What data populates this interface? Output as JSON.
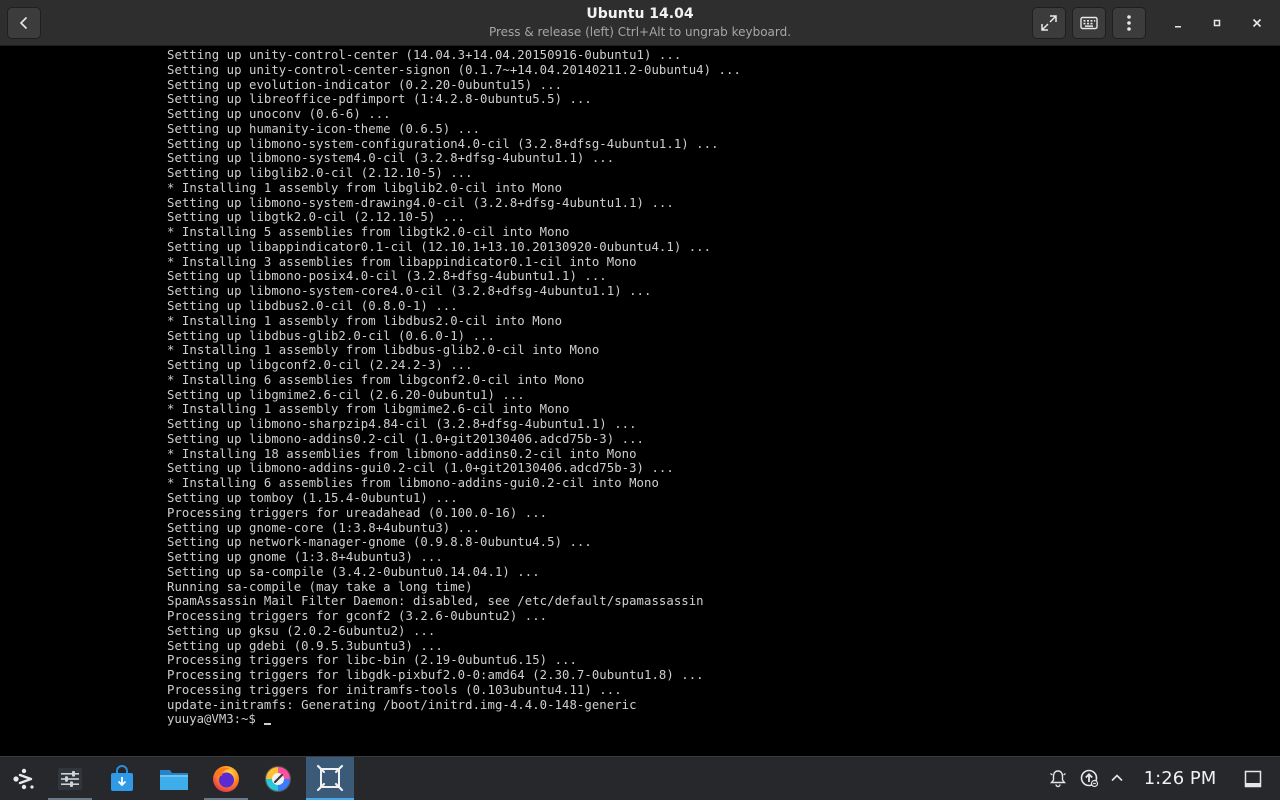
{
  "window": {
    "title": "Ubuntu 14.04",
    "subtitle": "Press & release (left) Ctrl+Alt to ungrab keyboard."
  },
  "icons": {
    "back": "chevron-left-icon",
    "fullscreen": "fullscreen-icon",
    "keyboard": "keyboard-icon",
    "menu": "kebab-menu-icon",
    "minimize": "minimize-icon",
    "maximize": "maximize-icon",
    "close": "close-icon"
  },
  "terminal": {
    "lines": [
      "Setting up unity-control-center (14.04.3+14.04.20150916-0ubuntu1) ...",
      "Setting up unity-control-center-signon (0.1.7~+14.04.20140211.2-0ubuntu4) ...",
      "Setting up evolution-indicator (0.2.20-0ubuntu15) ...",
      "Setting up libreoffice-pdfimport (1:4.2.8-0ubuntu5.5) ...",
      "Setting up unoconv (0.6-6) ...",
      "Setting up humanity-icon-theme (0.6.5) ...",
      "Setting up libmono-system-configuration4.0-cil (3.2.8+dfsg-4ubuntu1.1) ...",
      "Setting up libmono-system4.0-cil (3.2.8+dfsg-4ubuntu1.1) ...",
      "Setting up libglib2.0-cil (2.12.10-5) ...",
      "* Installing 1 assembly from libglib2.0-cil into Mono",
      "Setting up libmono-system-drawing4.0-cil (3.2.8+dfsg-4ubuntu1.1) ...",
      "Setting up libgtk2.0-cil (2.12.10-5) ...",
      "* Installing 5 assemblies from libgtk2.0-cil into Mono",
      "Setting up libappindicator0.1-cil (12.10.1+13.10.20130920-0ubuntu4.1) ...",
      "* Installing 3 assemblies from libappindicator0.1-cil into Mono",
      "Setting up libmono-posix4.0-cil (3.2.8+dfsg-4ubuntu1.1) ...",
      "Setting up libmono-system-core4.0-cil (3.2.8+dfsg-4ubuntu1.1) ...",
      "Setting up libdbus2.0-cil (0.8.0-1) ...",
      "* Installing 1 assembly from libdbus2.0-cil into Mono",
      "Setting up libdbus-glib2.0-cil (0.6.0-1) ...",
      "* Installing 1 assembly from libdbus-glib2.0-cil into Mono",
      "Setting up libgconf2.0-cil (2.24.2-3) ...",
      "* Installing 6 assemblies from libgconf2.0-cil into Mono",
      "Setting up libgmime2.6-cil (2.6.20-0ubuntu1) ...",
      "* Installing 1 assembly from libgmime2.6-cil into Mono",
      "Setting up libmono-sharpzip4.84-cil (3.2.8+dfsg-4ubuntu1.1) ...",
      "Setting up libmono-addins0.2-cil (1.0+git20130406.adcd75b-3) ...",
      "* Installing 18 assemblies from libmono-addins0.2-cil into Mono",
      "Setting up libmono-addins-gui0.2-cil (1.0+git20130406.adcd75b-3) ...",
      "* Installing 6 assemblies from libmono-addins-gui0.2-cil into Mono",
      "Setting up tomboy (1.15.4-0ubuntu1) ...",
      "Processing triggers for ureadahead (0.100.0-16) ...",
      "Setting up gnome-core (1:3.8+4ubuntu3) ...",
      "Setting up network-manager-gnome (0.9.8.8-0ubuntu4.5) ...",
      "Setting up gnome (1:3.8+4ubuntu3) ...",
      "Setting up sa-compile (3.4.2-0ubuntu0.14.04.1) ...",
      "Running sa-compile (may take a long time)",
      "SpamAssassin Mail Filter Daemon: disabled, see /etc/default/spamassassin",
      "Processing triggers for gconf2 (3.2.6-0ubuntu2) ...",
      "Setting up gksu (2.0.2-6ubuntu2) ...",
      "Setting up gdebi (0.9.5.3ubuntu3) ...",
      "Processing triggers for libc-bin (2.19-0ubuntu6.15) ...",
      "Processing triggers for libgdk-pixbuf2.0-0:amd64 (2.30.7-0ubuntu1.8) ...",
      "Processing triggers for initramfs-tools (0.103ubuntu4.11) ...",
      "update-initramfs: Generating /boot/initrd.img-4.4.0-148-generic"
    ],
    "prompt": "yuuya@VM3:~$ "
  },
  "taskbar": {
    "apps": [
      {
        "name": "app-launcher",
        "icon": "app-launcher-icon"
      },
      {
        "name": "settings",
        "icon": "settings-sliders-icon"
      },
      {
        "name": "software-store",
        "icon": "store-bag-icon"
      },
      {
        "name": "files",
        "icon": "folder-icon"
      },
      {
        "name": "firefox",
        "icon": "firefox-icon"
      },
      {
        "name": "paint",
        "icon": "paint-palette-icon"
      },
      {
        "name": "virtual-machine",
        "icon": "vm-frame-icon"
      }
    ],
    "tray": {
      "notifications_icon": "bell-icon",
      "updates_icon": "update-icon",
      "expand_icon": "chevron-up-icon",
      "clock": "1:26 PM",
      "show_desktop_icon": "show-desktop-icon"
    }
  },
  "colors": {
    "terminal_bg": "#000000",
    "terminal_fg": "#cfcfcf",
    "header_bg": "#2e2e2e",
    "taskbar_bg": "#26282b",
    "active_task": "#3b5a78"
  }
}
